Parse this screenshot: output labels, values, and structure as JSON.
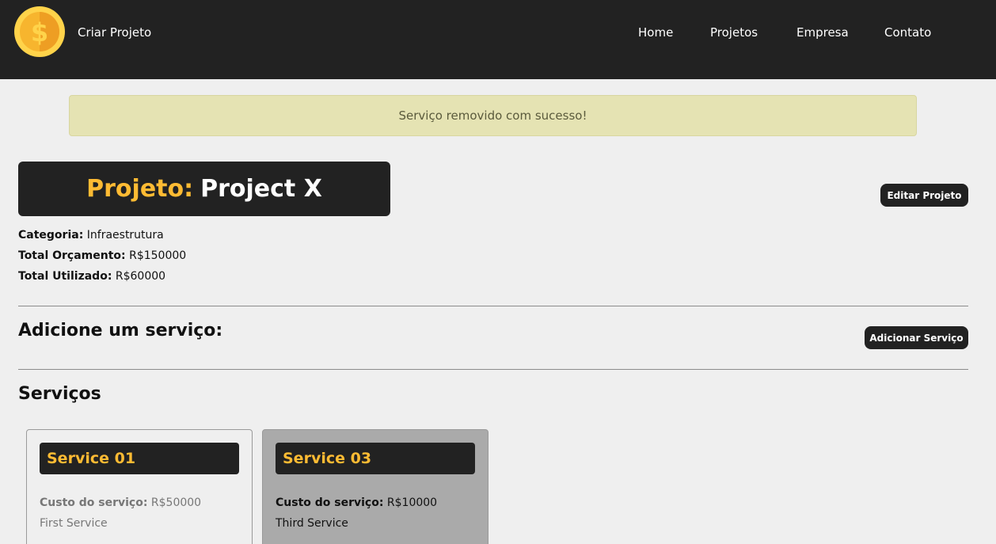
{
  "navbar": {
    "brand": "Criar Projeto",
    "logo_icon": "coin-dollar-icon",
    "links": [
      "Home",
      "Projetos",
      "Empresa",
      "Contato"
    ]
  },
  "message": "Serviço removido com sucesso!",
  "project": {
    "title_prefix": "Projeto:",
    "name": "Project X",
    "edit_label": "Editar Projeto",
    "category_label": "Categoria:",
    "category": "Infraestrutura",
    "budget_label": "Total Orçamento:",
    "budget": "R$150000",
    "used_label": "Total Utilizado:",
    "used": "R$60000"
  },
  "add_service": {
    "heading": "Adicione um serviço:",
    "button_label": "Adicionar Serviço"
  },
  "services": {
    "heading": "Serviços",
    "cost_label": "Custo do serviço:",
    "items": [
      {
        "name": "Service 01",
        "cost": "R$50000",
        "description": "First Service"
      },
      {
        "name": "Service 03",
        "cost": "R$10000",
        "description": "Third Service"
      }
    ]
  },
  "colors": {
    "accent": "#ffbb33",
    "dark": "#222222",
    "message_bg": "#e5e3b3"
  }
}
